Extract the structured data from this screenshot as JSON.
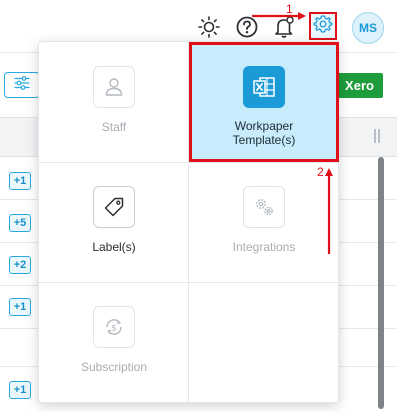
{
  "topbar": {
    "icons": [
      "sun-icon",
      "help-icon",
      "bell-icon",
      "gear-icon"
    ],
    "avatar_initials": "MS"
  },
  "background": {
    "xero_button_label": "Xero",
    "row_badges": [
      "+1",
      "+5",
      "+2",
      "+1",
      "+1"
    ]
  },
  "settings_menu": {
    "items": [
      {
        "label": "Staff",
        "icon": "user-icon",
        "enabled": false
      },
      {
        "label": "Workpaper Template(s)",
        "icon": "excel-icon",
        "enabled": true,
        "selected": true
      },
      {
        "label": "Label(s)",
        "icon": "tag-icon",
        "enabled": true
      },
      {
        "label": "Integrations",
        "icon": "gears-icon",
        "enabled": false
      },
      {
        "label": "Subscription",
        "icon": "subscription-icon",
        "enabled": false
      },
      {
        "label": "",
        "icon": "",
        "enabled": false
      }
    ]
  },
  "annotations": {
    "step1": "1",
    "step2": "2",
    "color": "#e0101a"
  },
  "colors": {
    "accent": "#1a9ad6",
    "selected_bg": "#c8ecfb",
    "xero_green": "#1f9d3c"
  }
}
